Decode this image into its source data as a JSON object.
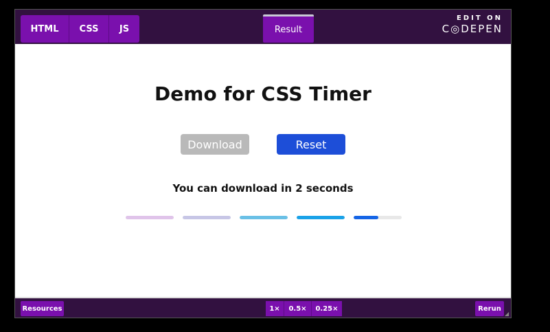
{
  "editor_tabs": {
    "html": "HTML",
    "css": "CSS",
    "js": "JS",
    "result": "Result"
  },
  "codepen": {
    "edit_on": "EDIT ON",
    "name": "C◎DEPEN"
  },
  "demo": {
    "title": "Demo for CSS Timer",
    "download_label": "Download",
    "reset_label": "Reset",
    "message": "You can download in 2 seconds"
  },
  "progress_bars": [
    {
      "color": "#e0c4ea",
      "fill_fraction": 1.0
    },
    {
      "color": "#c7c6e6",
      "fill_fraction": 1.0
    },
    {
      "color": "#6ac0e6",
      "fill_fraction": 1.0
    },
    {
      "color": "#1aa2e8",
      "fill_fraction": 1.0
    },
    {
      "color": "#1565e6",
      "fill_fraction": 0.52
    }
  ],
  "bottom_bar": {
    "resources": "Resources",
    "zoom_options": [
      "1×",
      "0.5×",
      "0.25×"
    ],
    "rerun": "Rerun"
  },
  "colors": {
    "bar_background": "#321140",
    "button": "#7a10ad",
    "reset": "#1d4ed8"
  }
}
